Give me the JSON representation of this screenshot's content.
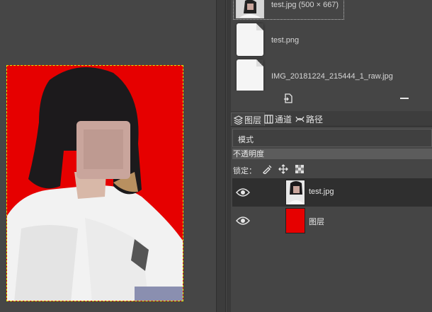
{
  "images_panel": {
    "items": [
      {
        "label": "test.jpg (500 × 667)"
      },
      {
        "label": "test.png"
      },
      {
        "label": "IMG_20181224_215444_1_raw.jpg"
      }
    ]
  },
  "tabs": [
    {
      "label": "图层",
      "icon": "layers-icon"
    },
    {
      "label": "通道",
      "icon": "channels-icon"
    },
    {
      "label": "路径",
      "icon": "paths-icon"
    }
  ],
  "layers_panel": {
    "mode_label": "模式",
    "opacity_label": "不透明度",
    "lock_label": "锁定：",
    "layers": [
      {
        "name": "test.jpg",
        "visible": true,
        "selected": true
      },
      {
        "name": "图层",
        "visible": true,
        "selected": false,
        "fill": "#e60000"
      }
    ]
  },
  "colors": {
    "background_red": "#e60000",
    "selection_outline": "#e6e600"
  }
}
